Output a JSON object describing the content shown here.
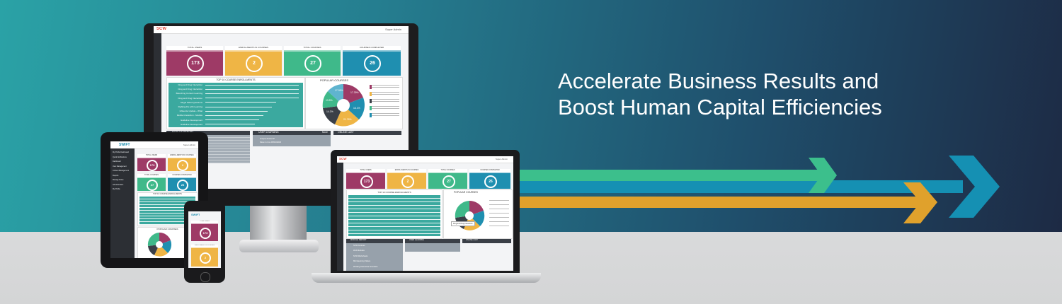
{
  "headline": {
    "line1": "Accelerate Business Results and",
    "line2": "Boost Human Capital Efficiencies"
  },
  "colors": {
    "tile_red": "#9e3a66",
    "tile_orange": "#efb545",
    "tile_green": "#3fb98a",
    "tile_blue": "#1f8fb0",
    "arrow_green": "#3cbf8c",
    "arrow_blue": "#1590b3",
    "arrow_orange": "#e0a12c"
  },
  "monitor": {
    "logo": "SCW",
    "user": "Super Admin",
    "tiles": [
      {
        "label": "TOTAL USERS",
        "value": "173"
      },
      {
        "label": "ENROLLMENTS IN COURSES",
        "value": "2"
      },
      {
        "label": "TOTAL COURSES",
        "value": "27"
      },
      {
        "label": "COURSES COMPLETED",
        "value": "26"
      }
    ],
    "enrollments_title": "TOP 10 COURSE ENROLLMENTS",
    "popular_title": "POPULAR COURSES",
    "course_rows": [
      "Drug and Drug Interaction",
      "Drug and Drug Interaction",
      "Branching Content Learning",
      "Drug and Drug Interaction",
      "Single Sided Questions",
      "Fighting Flu with Learning",
      "Influenza Update - What",
      "Mobile Interaction - Module",
      "Guideline Development",
      "Guideline Development"
    ],
    "pie_labels": [
      "17.39%",
      "16.1%",
      "21.76%",
      "14.2%",
      "13.5%",
      "17.05%"
    ],
    "panel_module": "MODULE REPORT",
    "panel_users": "USER LEARNING",
    "panel_users_more": "More",
    "panel_online": "ONLINE LAST",
    "user_entries": [
      "Anupa Anand P",
      "Slow in Ins 25/03/2016"
    ]
  },
  "tablet": {
    "logo": "SWIFT",
    "user": "Super Admin",
    "menu": [
      "My Profile Dashboard",
      "Quick Notifications",
      "Dashboard",
      "User Management",
      "Content Management",
      "Reports",
      "Manage Roles",
      "Administration",
      "My Profile"
    ],
    "tiles": [
      {
        "label": "TOTAL USERS",
        "value": "173"
      },
      {
        "label": "ENROLLMENTS IN COURSES",
        "value": "2"
      },
      {
        "label": "TOTAL COURSES",
        "value": "27"
      },
      {
        "label": "COURSES COMPLETED",
        "value": "26"
      }
    ],
    "enrollments_title": "TOP 10 COURSE ENROLLMENTS",
    "popular_title": "POPULAR COURSES"
  },
  "phone": {
    "logo": "SWIFT",
    "tiles": [
      {
        "label": "TOTAL USERS",
        "value": "173"
      },
      {
        "label": "ENROLLMENTS IN COURSES",
        "value": "2"
      }
    ]
  },
  "laptop": {
    "logo": "SCW",
    "user": "Super Admin",
    "tiles": [
      {
        "label": "TOTAL USERS",
        "value": "173"
      },
      {
        "label": "ENROLLMENTS IN COURSES",
        "value": "2"
      },
      {
        "label": "TOTAL COURSES",
        "value": "27"
      },
      {
        "label": "COURSES COMPLETED",
        "value": "26"
      }
    ],
    "enrollments_title": "TOP 10 COURSE ENROLLMENTS",
    "popular_title": "POPULAR COURSES",
    "panel_module": "MODULE REPORT",
    "panel_users": "USER LEARNING",
    "panel_online": "ONLINE LAST",
    "module_rows": [
      "SCW Courses",
      "Web Modules",
      "SCW Worksheets",
      "Microlearning Videos",
      "Working Interactive Scenarios"
    ],
    "tooltip": "Drug and Drug Interaction"
  }
}
